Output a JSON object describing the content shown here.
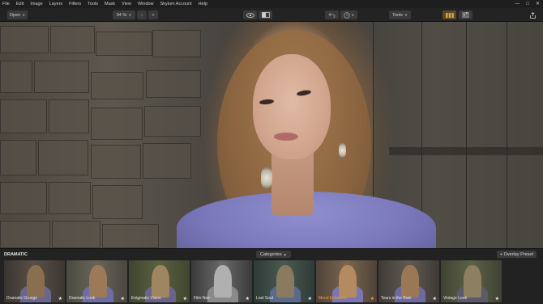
{
  "menu": [
    "File",
    "Edit",
    "Image",
    "Layers",
    "Filters",
    "Tools",
    "Mask",
    "View",
    "Window",
    "Skylum Account",
    "Help"
  ],
  "window_controls": {
    "minimize": "—",
    "maximize": "□",
    "close": "✕"
  },
  "toolbar": {
    "open_label": "Open",
    "zoom_value": "94 %",
    "zoom_out": "−",
    "zoom_in": "+",
    "eye_icon": "eye-icon",
    "compare_icon": "compare-icon",
    "undo_icon": "undo-icon",
    "history_icon": "history-icon",
    "tools_label": "Tools",
    "share_icon": "share-icon"
  },
  "panel": {
    "title": "DRAMATIC",
    "categories_label": "Categories",
    "overlay_label": "+ Overlay Preset",
    "thumbnails": [
      {
        "label": "Dramatic Grunge",
        "star": "★"
      },
      {
        "label": "Dramatic Look",
        "star": "★"
      },
      {
        "label": "Enigmatic Vision",
        "star": "★"
      },
      {
        "label": "Film Noir",
        "star": "★"
      },
      {
        "label": "Lost Soul",
        "star": "★"
      },
      {
        "label": "Mood Enhancer",
        "star": "★"
      },
      {
        "label": "Tears in the Rain",
        "star": "★"
      },
      {
        "label": "Vintage Look",
        "star": "★"
      }
    ],
    "selected_index": 5,
    "accent_color": "#f0a23a"
  }
}
